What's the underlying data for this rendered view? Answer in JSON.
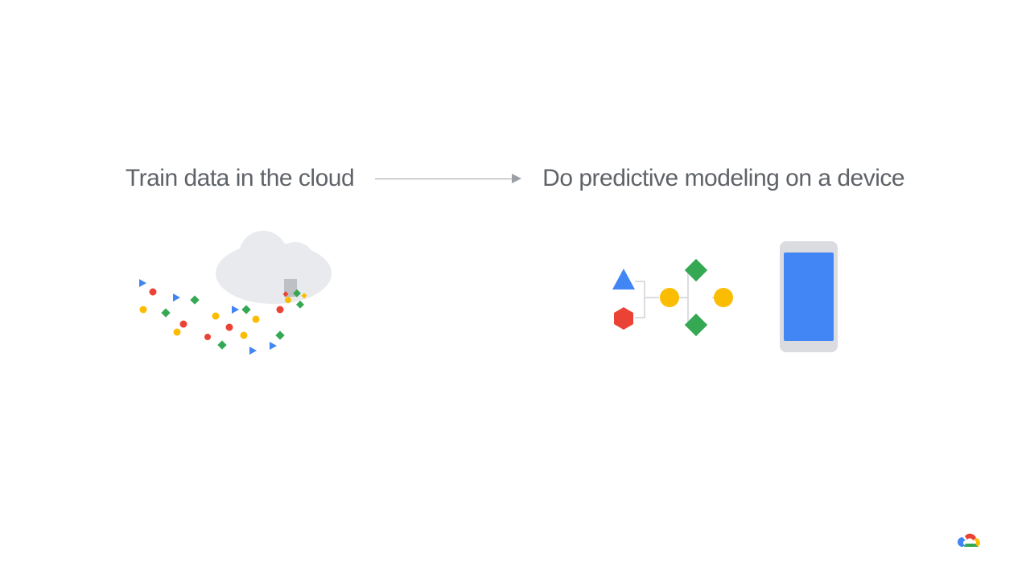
{
  "headings": {
    "left": "Train data in the cloud",
    "right": "Do predictive modeling on a device"
  },
  "colors": {
    "blue": "#4285f4",
    "red": "#ea4335",
    "yellow": "#fbbc04",
    "green": "#34a853",
    "grey": "#5f6368",
    "cloud": "#e8eaed"
  }
}
